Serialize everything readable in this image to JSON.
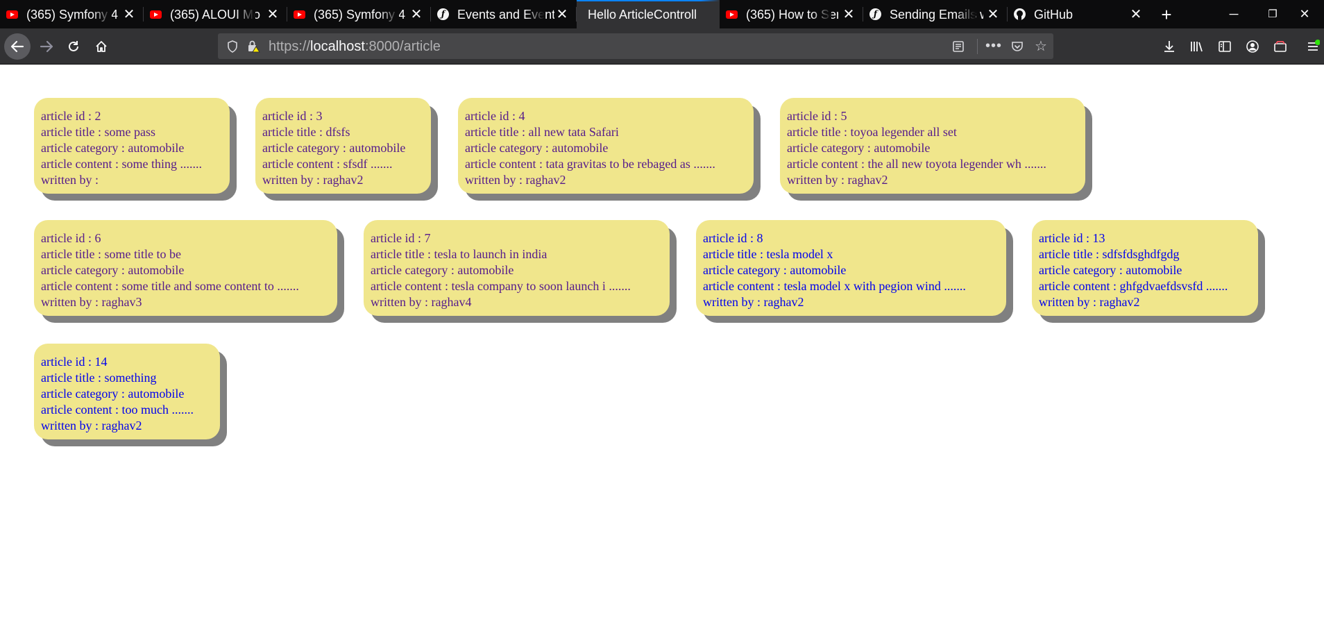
{
  "tabs": [
    {
      "label": "(365) Symfony 4",
      "icon": "youtube-icon",
      "active": false
    },
    {
      "label": "(365) ALOUI Mo",
      "icon": "youtube-icon",
      "active": false
    },
    {
      "label": "(365) Symfony 4",
      "icon": "youtube-icon",
      "active": false
    },
    {
      "label": "Events and Event",
      "icon": "symfony-icon",
      "active": false
    },
    {
      "label": "Hello ArticleControll",
      "icon": "",
      "active": true
    },
    {
      "label": "(365) How to Ser",
      "icon": "youtube-icon",
      "active": false
    },
    {
      "label": "Sending Emails w",
      "icon": "symfony-icon",
      "active": false
    },
    {
      "label": "GitHub",
      "icon": "github-icon",
      "active": false
    }
  ],
  "address": {
    "scheme": "https://",
    "host": "localhost",
    "rest": ":8000/article"
  },
  "articles": [
    {
      "id_line": "article id : 2",
      "title_line": "article title : some pass",
      "category_line": "article category : automobile",
      "content_line": "article content : some thing .......",
      "author_line": "written by :",
      "visited": true
    },
    {
      "id_line": "article id : 3",
      "title_line": "article title : dfsfs",
      "category_line": "article category : automobile",
      "content_line": "article content : sfsdf .......",
      "author_line": "written by : raghav2",
      "visited": true
    },
    {
      "id_line": "article id : 4",
      "title_line": "article title : all new tata Safari",
      "category_line": "article category : automobile",
      "content_line": "article content : tata gravitas to be rebaged as .......",
      "author_line": "written by : raghav2",
      "visited": true
    },
    {
      "id_line": "article id : 5",
      "title_line": "article title : toyoa legender all set",
      "category_line": "article category : automobile",
      "content_line": "article content : the all new toyota legender wh .......",
      "author_line": "written by : raghav2",
      "visited": true
    },
    {
      "id_line": "article id : 6",
      "title_line": "article title : some title to be",
      "category_line": "article category : automobile",
      "content_line": "article content : some title and some content to .......",
      "author_line": "written by : raghav3",
      "visited": true
    },
    {
      "id_line": "article id : 7",
      "title_line": "article title : tesla to launch in india",
      "category_line": "article category : automobile",
      "content_line": "article content : tesla company to soon launch i .......",
      "author_line": "written by : raghav4",
      "visited": true
    },
    {
      "id_line": "article id : 8",
      "title_line": "article title : tesla model x",
      "category_line": "article category : automobile",
      "content_line": "article content : tesla model x with pegion wind .......",
      "author_line": "written by : raghav2",
      "visited": false
    },
    {
      "id_line": "article id : 13",
      "title_line": "article title : sdfsfdsghdfgdg",
      "category_line": "article category : automobile",
      "content_line": "article content : ghfgdvaefdsvsfd .......",
      "author_line": "written by : raghav2",
      "visited": false
    },
    {
      "id_line": "article id : 14",
      "title_line": "article title : something",
      "category_line": "article category : automobile",
      "content_line": "article content : too much .......",
      "author_line": "written by : raghav2",
      "visited": false
    }
  ]
}
